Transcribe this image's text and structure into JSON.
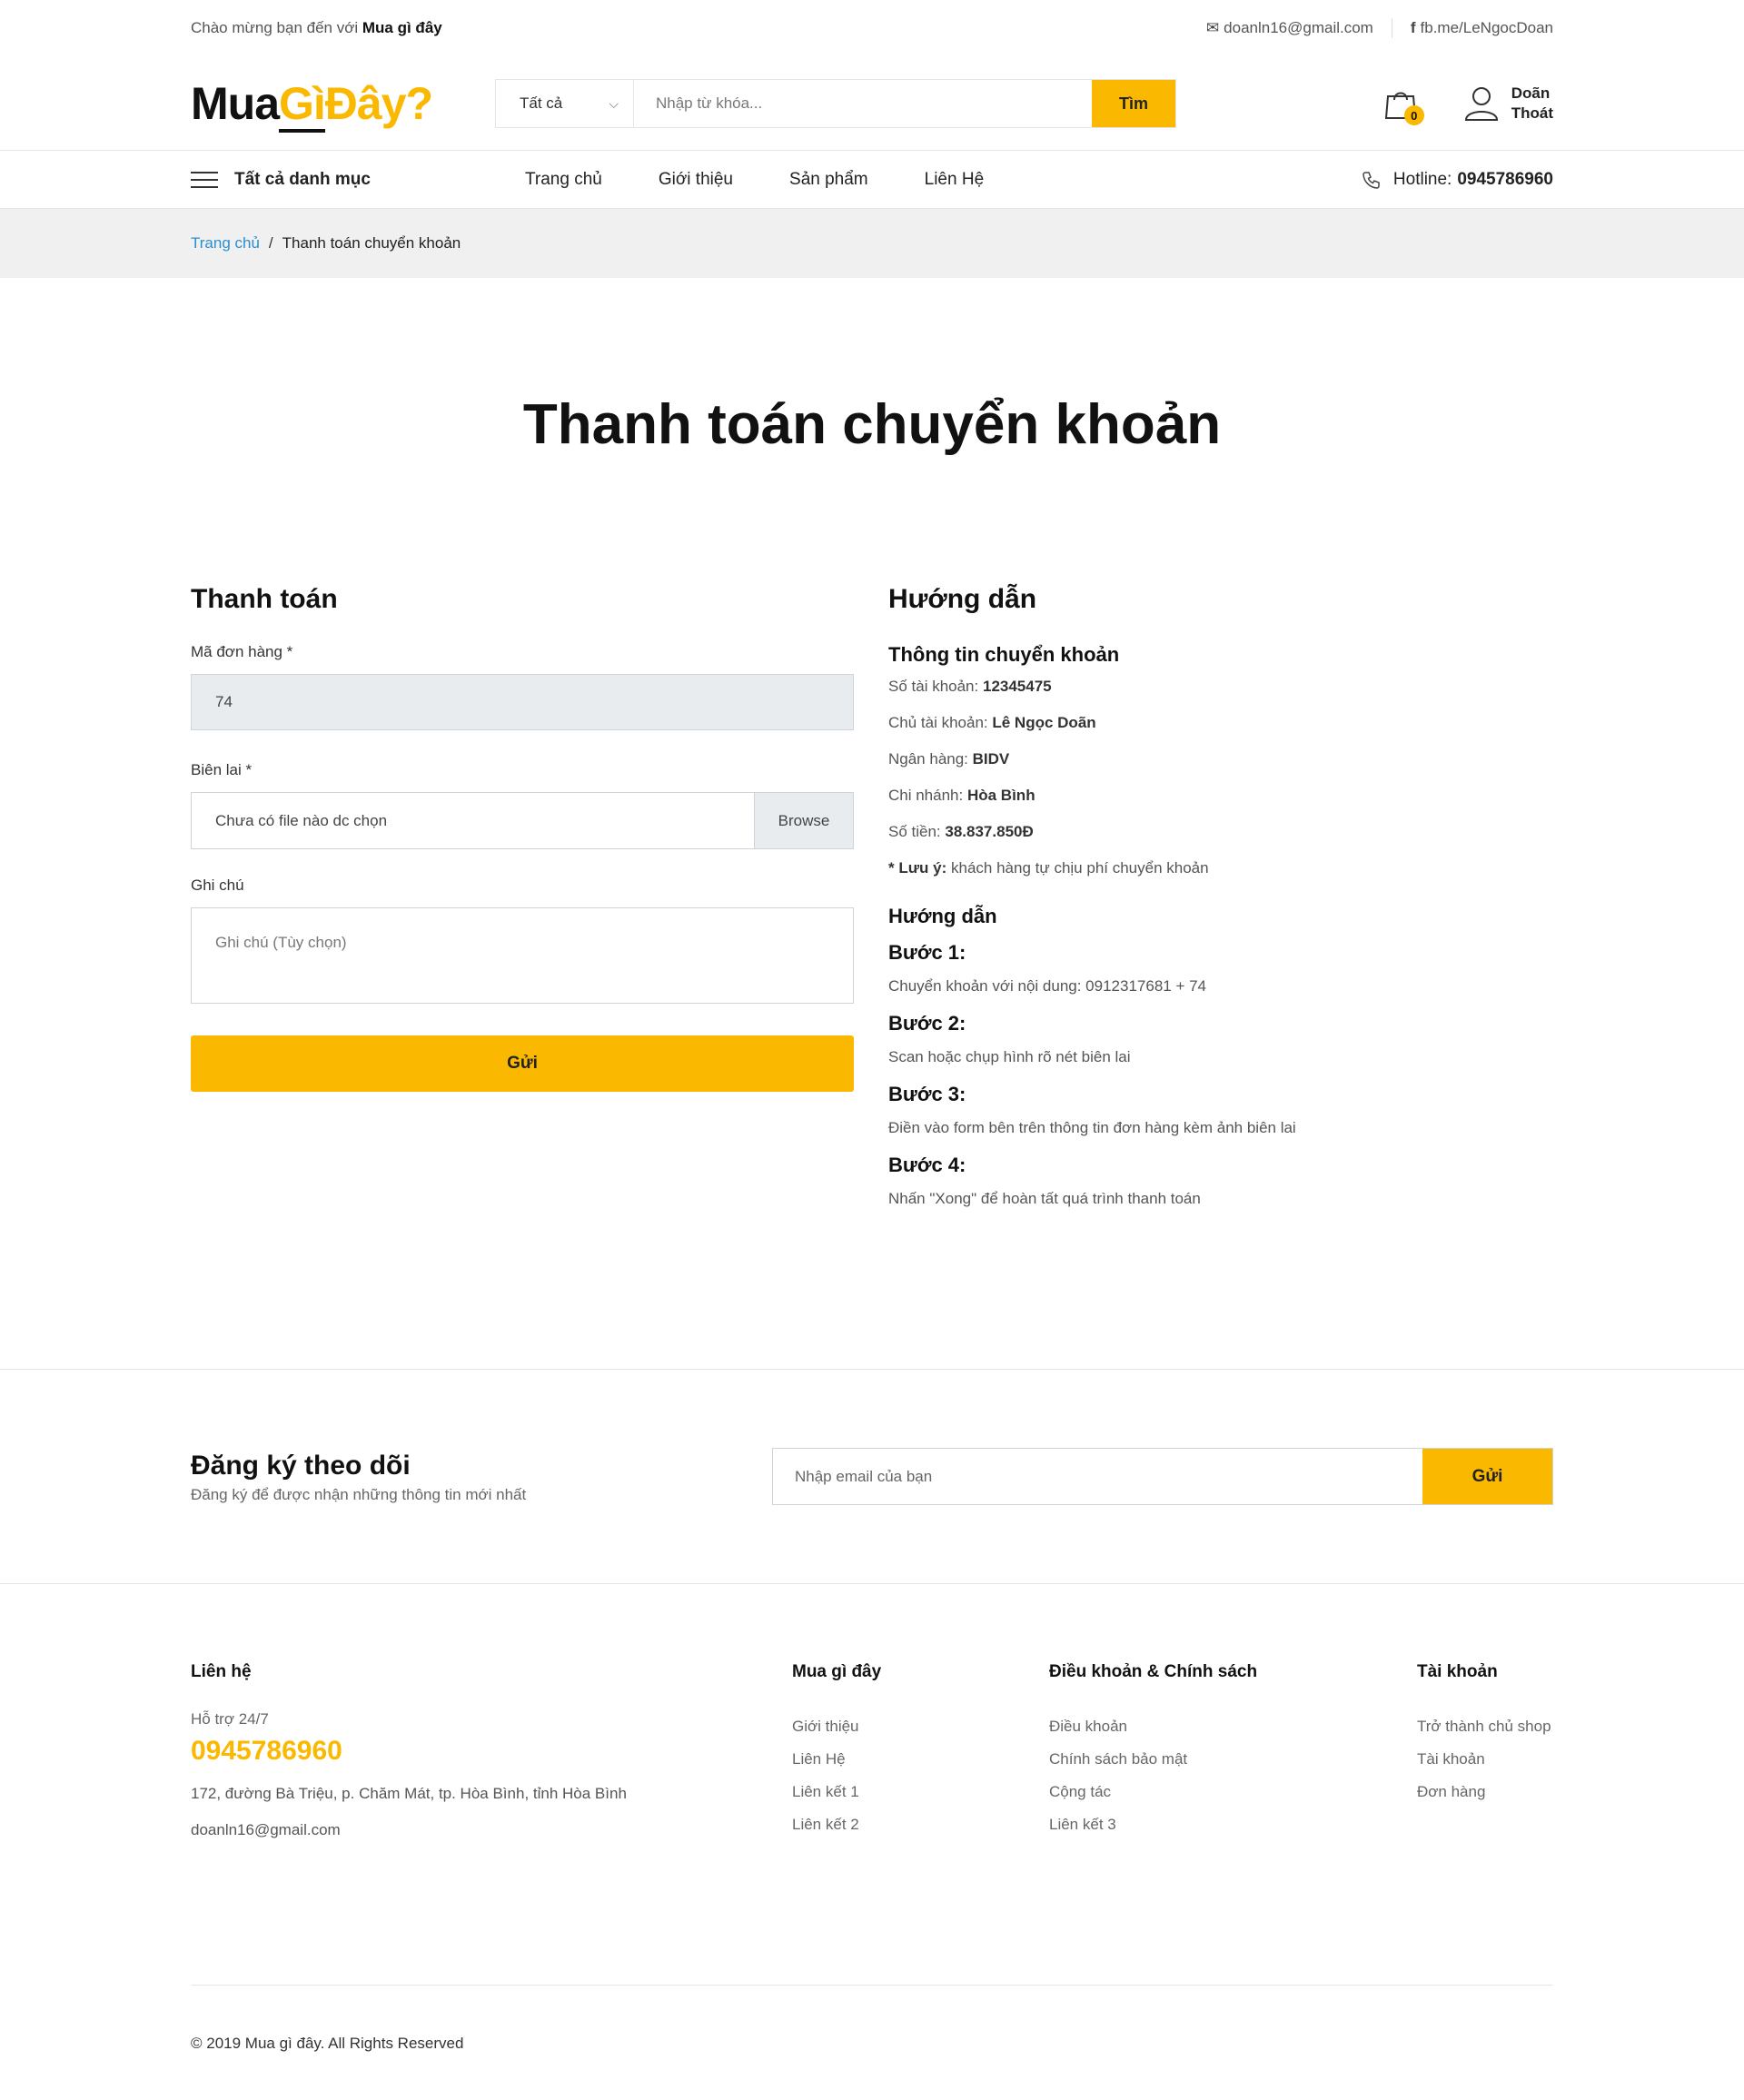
{
  "topbar": {
    "welcome_prefix": "Chào mừng bạn đến với",
    "welcome_brand": "Mua gì đây",
    "email": "doanln16@gmail.com",
    "facebook": "fb.me/LeNgocDoan"
  },
  "logo": {
    "part1": "Mua",
    "part2": "Gì",
    "part3": "Đây?"
  },
  "search": {
    "category": "Tất cả",
    "placeholder": "Nhập từ khóa...",
    "button": "Tìm"
  },
  "cart": {
    "count": "0"
  },
  "user": {
    "name": "Doãn",
    "logout": "Thoát"
  },
  "nav": {
    "all_categories": "Tất cả danh mục",
    "items": [
      "Trang chủ",
      "Giới thiệu",
      "Sản phẩm",
      "Liên Hệ"
    ],
    "hotline_label": "Hotline:",
    "hotline_number": "0945786960"
  },
  "breadcrumb": {
    "home": "Trang chủ",
    "current": "Thanh toán chuyển khoản"
  },
  "page_title": "Thanh toán chuyển khoản",
  "payment_form": {
    "title": "Thanh toán",
    "order_label": "Mã đơn hàng *",
    "order_value": "74",
    "receipt_label": "Biên lai *",
    "receipt_value": "Chưa có file nào dc chọn",
    "browse": "Browse",
    "note_label": "Ghi chú",
    "note_placeholder": "Ghi chú (Tùy chọn)",
    "submit": "Gửi"
  },
  "guide": {
    "title": "Hướng dẫn",
    "transfer_info_title": "Thông tin chuyển khoản",
    "account_no_label": "Số tài khoản:",
    "account_no": "12345475",
    "holder_label": "Chủ tài khoản:",
    "holder": "Lê Ngọc Doãn",
    "bank_label": "Ngân hàng:",
    "bank": "BIDV",
    "branch_label": "Chi nhánh:",
    "branch": "Hòa Bình",
    "amount_label": "Số tiền:",
    "amount": "38.837.850Đ",
    "note_label": "* Lưu ý:",
    "note_text": "khách hàng tự chịu phí chuyển khoản",
    "steps_title": "Hướng dẫn",
    "steps": [
      {
        "title": "Bước 1:",
        "text": "Chuyển khoản với nội dung: 0912317681 + 74"
      },
      {
        "title": "Bước 2:",
        "text": "Scan hoặc chụp hình rõ nét biên lai"
      },
      {
        "title": "Bước 3:",
        "text": "Điền vào form bên trên thông tin đơn hàng kèm ảnh biên lai"
      },
      {
        "title": "Bước 4:",
        "text": "Nhấn \"Xong\" để hoàn tất quá trình thanh toán"
      }
    ]
  },
  "newsletter": {
    "title": "Đăng ký theo dõi",
    "subtitle": "Đăng ký để được nhận những thông tin mới nhất",
    "placeholder": "Nhập email của bạn",
    "button": "Gửi"
  },
  "footer": {
    "contact": {
      "title": "Liên hệ",
      "support": "Hỗ trợ 24/7",
      "phone": "0945786960",
      "address": "172, đường Bà Triệu, p. Chăm Mát, tp. Hòa Bình, tỉnh Hòa Bình",
      "email": "doanln16@gmail.com"
    },
    "muagiday": {
      "title": "Mua gì đây",
      "links": [
        "Giới thiệu",
        "Liên Hệ",
        "Liên kết 1",
        "Liên kết 2"
      ]
    },
    "policy": {
      "title": "Điều khoản & Chính sách",
      "links": [
        "Điều khoản",
        "Chính sách bảo mật",
        "Cộng tác",
        "Liên kết 3"
      ]
    },
    "account": {
      "title": "Tài khoản",
      "links": [
        "Trở thành chủ shop",
        "Tài khoản",
        "Đơn hàng"
      ]
    },
    "copyright": "© 2019 Mua gì đây. All Rights Reserved"
  },
  "colors": {
    "accent": "#fbb800",
    "link": "#2a8fd0"
  }
}
